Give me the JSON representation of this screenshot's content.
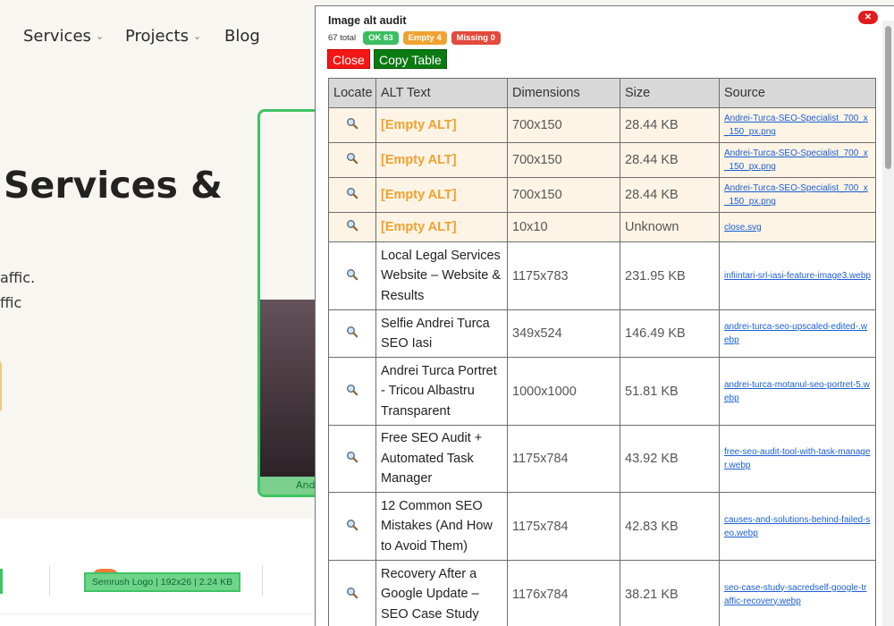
{
  "site": {
    "nav": [
      {
        "label": "Services",
        "has_dropdown": true
      },
      {
        "label": "Projects",
        "has_dropdown": true
      },
      {
        "label": "Blog",
        "has_dropdown": false
      }
    ],
    "hero_title": "Services &",
    "hero_lines": [
      "affic.",
      "ffic"
    ],
    "hero_image_caption": "Andre",
    "logo_caption": "Semrush Logo | 192x26 | 2.24 KB",
    "chevron_glyph": "⌄"
  },
  "panel": {
    "title": "Image alt audit",
    "close_x": "✕",
    "stats": {
      "total": "67 total",
      "ok": "OK 63",
      "empty": "Empty 4",
      "missing": "Missing 0"
    },
    "colors": {
      "ok": "#3bbf62",
      "empty": "#f0a231",
      "missing": "#e24a3b",
      "close_button": "#f41616",
      "copy_button": "#0b7a12",
      "empty_row_bg": "#fdf4e5",
      "link": "#1c5fd4"
    },
    "buttons": {
      "close": "Close",
      "copy": "Copy Table"
    },
    "table": {
      "headers": [
        "Locate",
        "ALT Text",
        "Dimensions",
        "Size",
        "Source"
      ],
      "locate_icon": "magnifier-icon",
      "rows": [
        {
          "empty": true,
          "alt": "[Empty ALT]",
          "dims": "700x150",
          "size": "28.44 KB",
          "source": "Andrei-Turca-SEO-Specialist_700_x_150_px.png"
        },
        {
          "empty": true,
          "alt": "[Empty ALT]",
          "dims": "700x150",
          "size": "28.44 KB",
          "source": "Andrei-Turca-SEO-Specialist_700_x_150_px.png"
        },
        {
          "empty": true,
          "alt": "[Empty ALT]",
          "dims": "700x150",
          "size": "28.44 KB",
          "source": "Andrei-Turca-SEO-Specialist_700_x_150_px.png"
        },
        {
          "empty": true,
          "alt": "[Empty ALT]",
          "dims": "10x10",
          "size": "Unknown",
          "source": "close.svg"
        },
        {
          "empty": false,
          "alt": "Local Legal Services Website – Website & Results",
          "dims": "1175x783",
          "size": "231.95 KB",
          "source": "infiintari-srl-iasi-feature-image3.webp"
        },
        {
          "empty": false,
          "alt": "Selfie Andrei Turca SEO Iasi",
          "dims": "349x524",
          "size": "146.49 KB",
          "source": "andrei-turca-seo-upscaled-edited-.webp"
        },
        {
          "empty": false,
          "alt": "Andrei Turca Portret - Tricou Albastru Transparent",
          "dims": "1000x1000",
          "size": "51.81 KB",
          "source": "andrei-turca-motanul-seo-portret-5.webp"
        },
        {
          "empty": false,
          "alt": "Free SEO Audit + Automated Task Manager",
          "dims": "1175x784",
          "size": "43.92 KB",
          "source": "free-seo-audit-tool-with-task-manager.webp"
        },
        {
          "empty": false,
          "alt": "12 Common SEO Mistakes (And How to Avoid Them)",
          "dims": "1175x784",
          "size": "42.83 KB",
          "source": "causes-and-solutions-behind-failed-seo.webp"
        },
        {
          "empty": false,
          "alt": "Recovery After a Google Update – SEO Case Study",
          "dims": "1176x784",
          "size": "38.21 KB",
          "source": "seo-case-study-sacredself-google-traffic-recovery.webp"
        }
      ]
    }
  }
}
